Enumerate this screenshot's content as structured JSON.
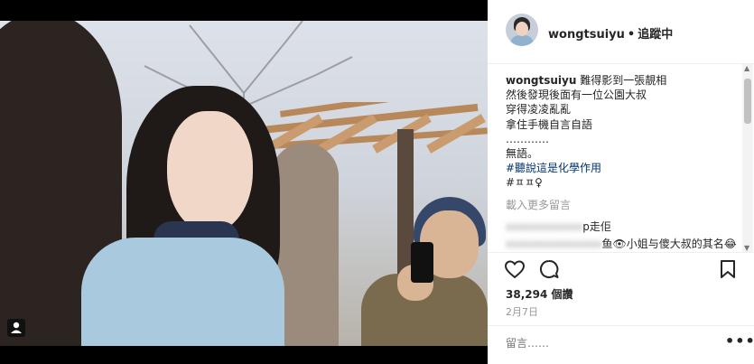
{
  "post": {
    "username": "wongtsuiyu",
    "separator": "•",
    "follow_status": "追蹤中",
    "caption_lines": [
      "難得影到一張靚相",
      "然後發現後面有一位公園大叔",
      "穿得凌凌亂亂",
      "拿住手機自言自語",
      "…………",
      "無語。"
    ],
    "hashtags": [
      "#聽說這是化學作用",
      "#ㅍㅍ♀"
    ],
    "load_more_label": "載入更多留言",
    "comments": [
      {
        "text": "p走佢"
      },
      {
        "text": "鱼👁小姐与傻大叔的其名😂"
      }
    ],
    "likes": "38,294 個讚",
    "date": "2月7日",
    "comment_placeholder": "留言……",
    "more_options": "•••"
  },
  "icons": {
    "like": "heart-icon",
    "comment": "comment-bubble-icon",
    "save": "bookmark-icon",
    "tagged": "person-tag-icon"
  },
  "colors": {
    "text": "#262626",
    "muted": "#999999",
    "hashtag": "#003569",
    "border": "#efefef"
  }
}
